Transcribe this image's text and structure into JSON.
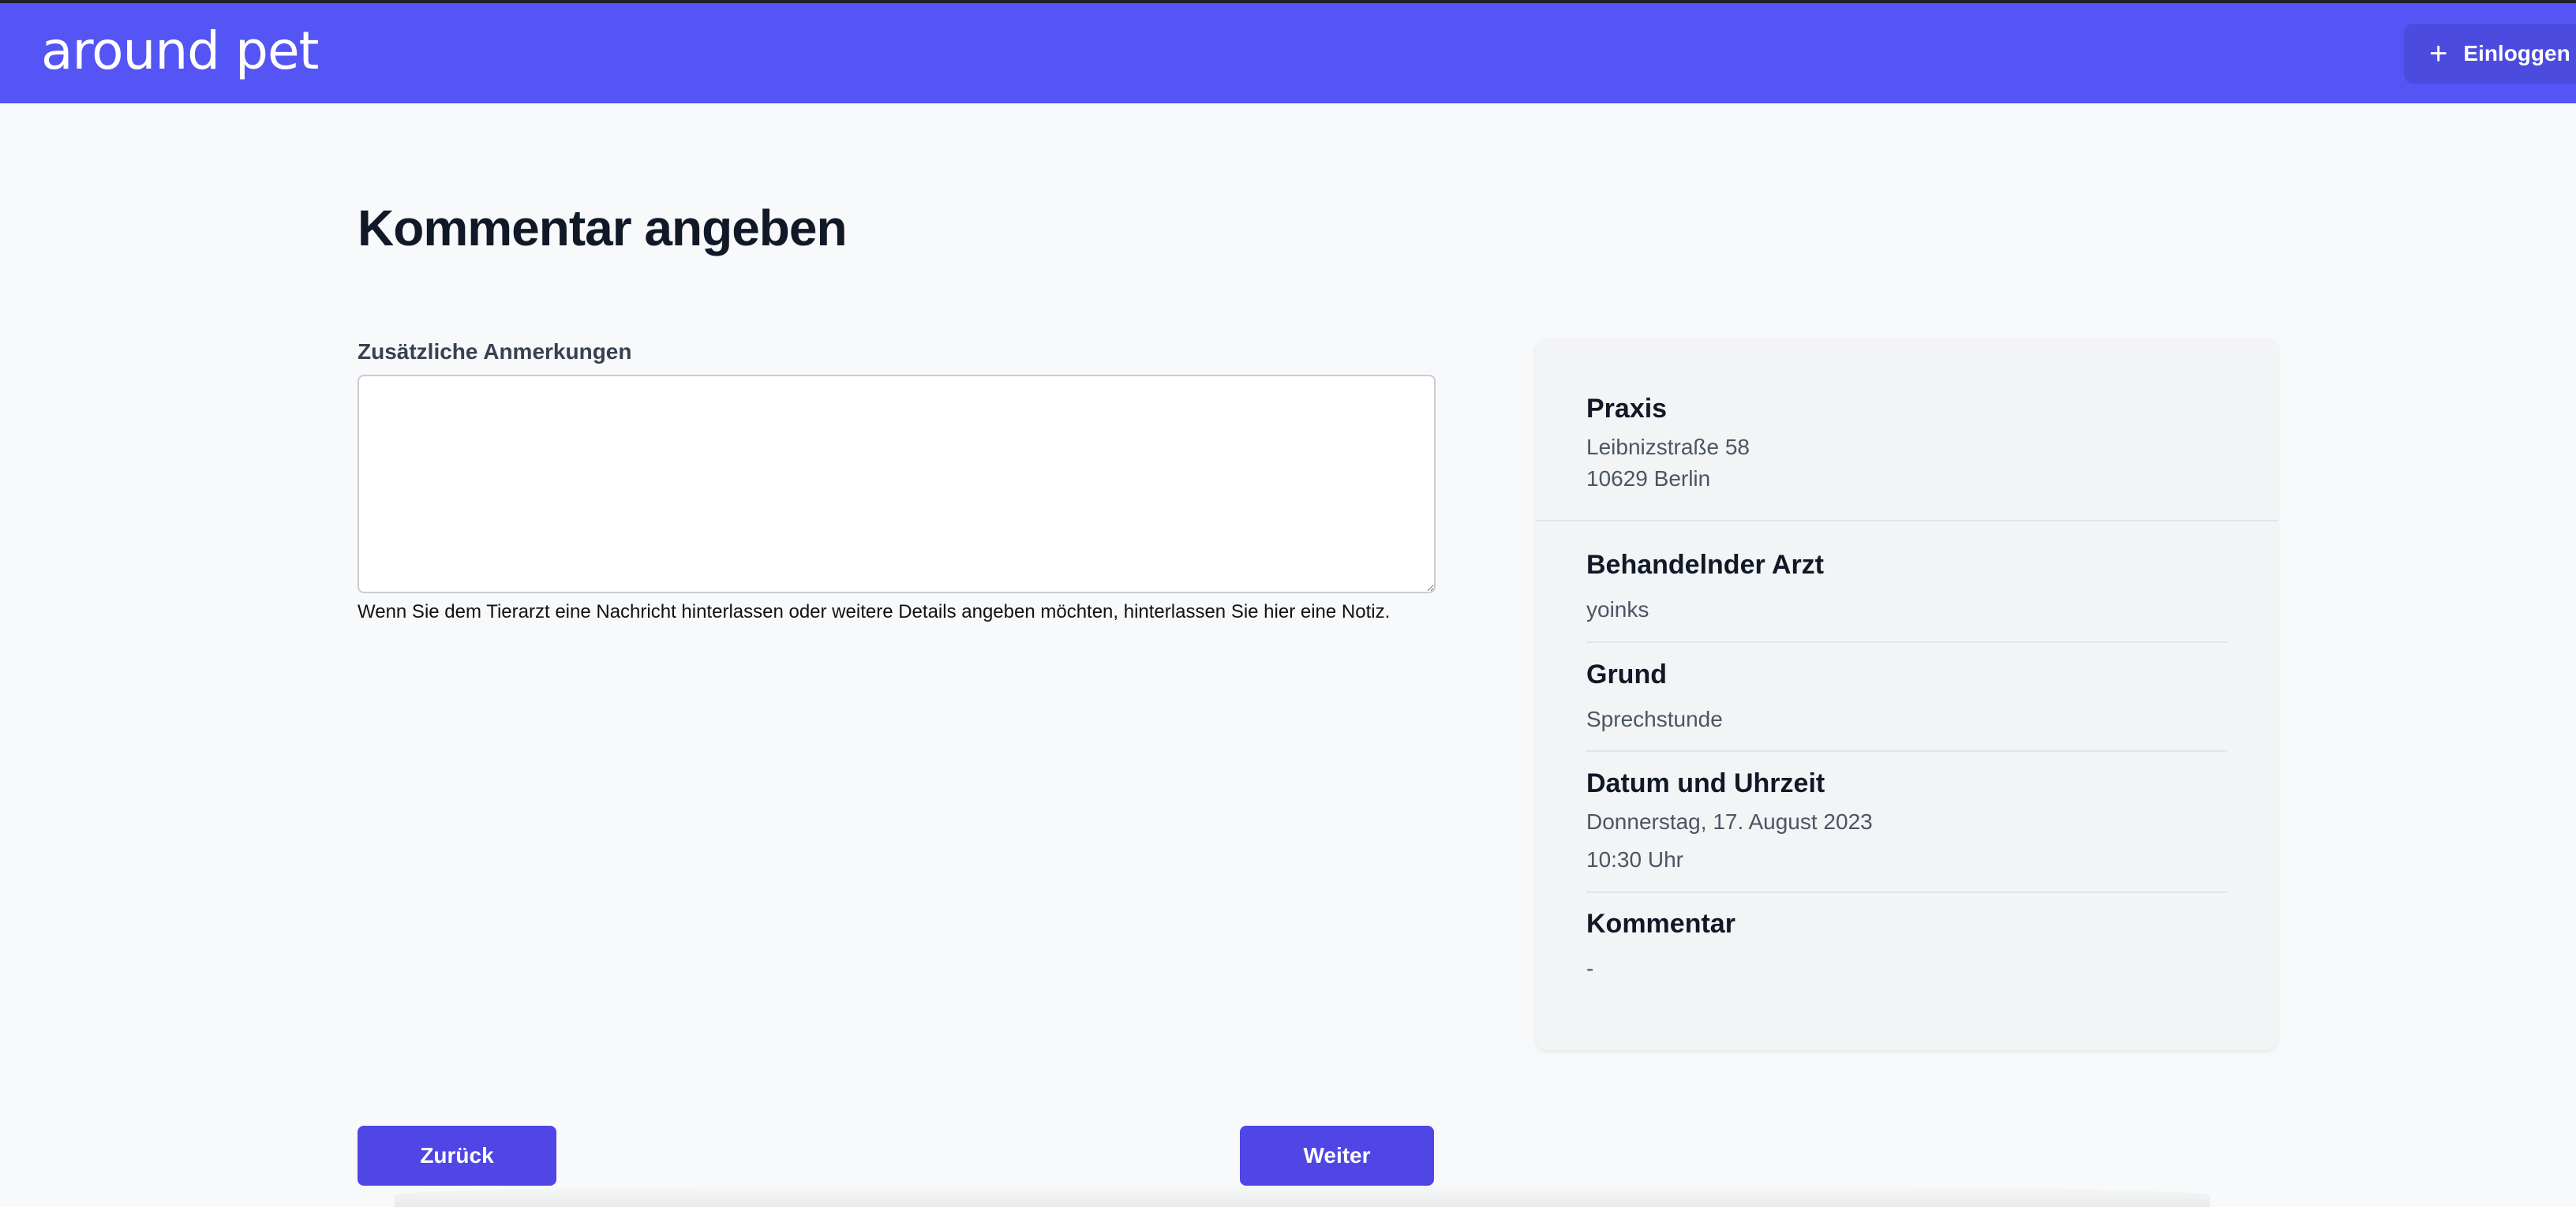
{
  "header": {
    "logo": "around pet",
    "login_icon": "plus-icon",
    "login_label": "Einloggen"
  },
  "page": {
    "title": "Kommentar angeben"
  },
  "form": {
    "label": "Zusätzliche Anmerkungen",
    "value": "",
    "helper": "Wenn Sie dem Tierarzt eine Nachricht hinterlassen oder weitere Details angeben möchten, hinterlassen Sie hier eine Notiz."
  },
  "summary": {
    "practice_title": "Praxis",
    "practice_street": "Leibnizstraße 58",
    "practice_city": "10629 Berlin",
    "doctor_title": "Behandelnder Arzt",
    "doctor_value": "yoinks",
    "reason_title": "Grund",
    "reason_value": "Sprechstunde",
    "datetime_title": "Datum und Uhrzeit",
    "date_value": "Donnerstag, 17. August 2023",
    "time_value": "10:30 Uhr",
    "comment_title": "Kommentar",
    "comment_value": "-"
  },
  "actions": {
    "back_label": "Zurück",
    "next_label": "Weiter"
  },
  "colors": {
    "header": "#5555f5",
    "button": "#4f46e5"
  }
}
